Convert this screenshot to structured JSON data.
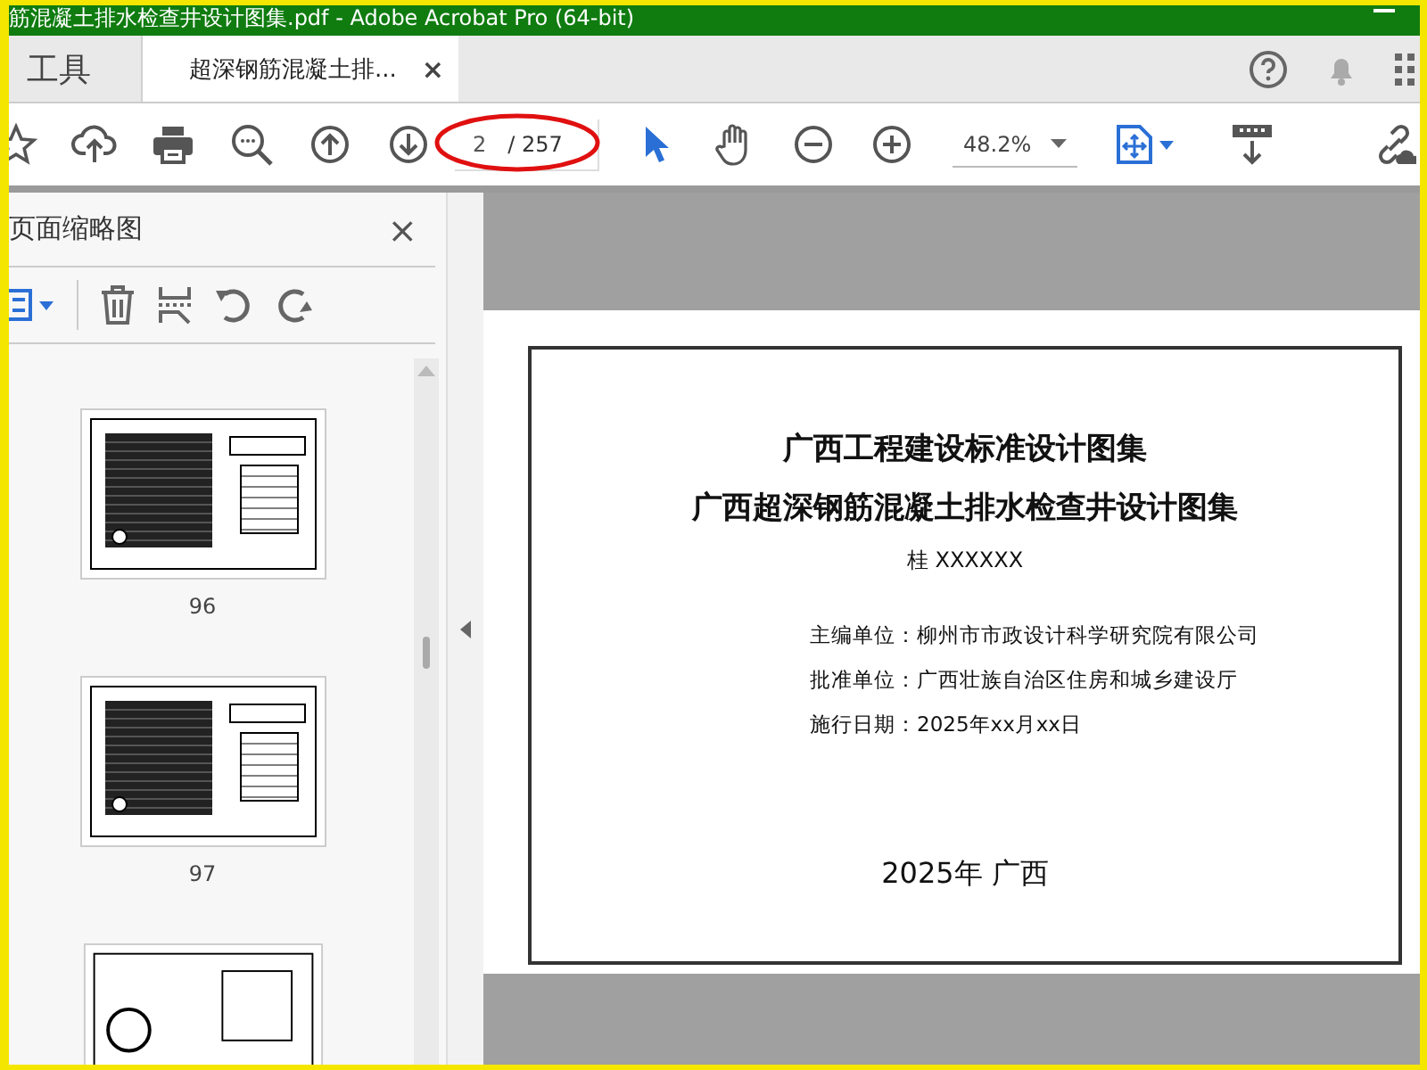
{
  "window": {
    "title": "筋混凝土排水检查井设计图集.pdf - Adobe Acrobat Pro (64-bit)"
  },
  "tabs": [
    {
      "label": "工具",
      "selected": false
    },
    {
      "label": "超深钢筋混凝土排...",
      "selected": true,
      "close": "×"
    }
  ],
  "toolbar": {
    "page_number": "2",
    "page_total": "/ 257",
    "zoom": "48.2%",
    "tools": [
      {
        "kind": "pointer",
        "selected": true
      },
      {
        "kind": "hand",
        "selected": false
      }
    ]
  },
  "sidebar": {
    "title": "页面缩略图",
    "close": "×",
    "thumbnails": [
      {
        "label": "96"
      },
      {
        "label": "97"
      }
    ]
  },
  "document": {
    "title_lines": [
      "广西工程建设标准设计图集",
      "广西超深钢筋混凝土排水检查井设计图集"
    ],
    "code": "桂  XXXXXX",
    "info": [
      "主编单位：柳州市市政设计科学研究院有限公司",
      "批准单位：广西壮族自治区住房和城乡建设厅",
      "施行日期：2025年xx月xx日"
    ],
    "footer": "2025年  广西"
  }
}
